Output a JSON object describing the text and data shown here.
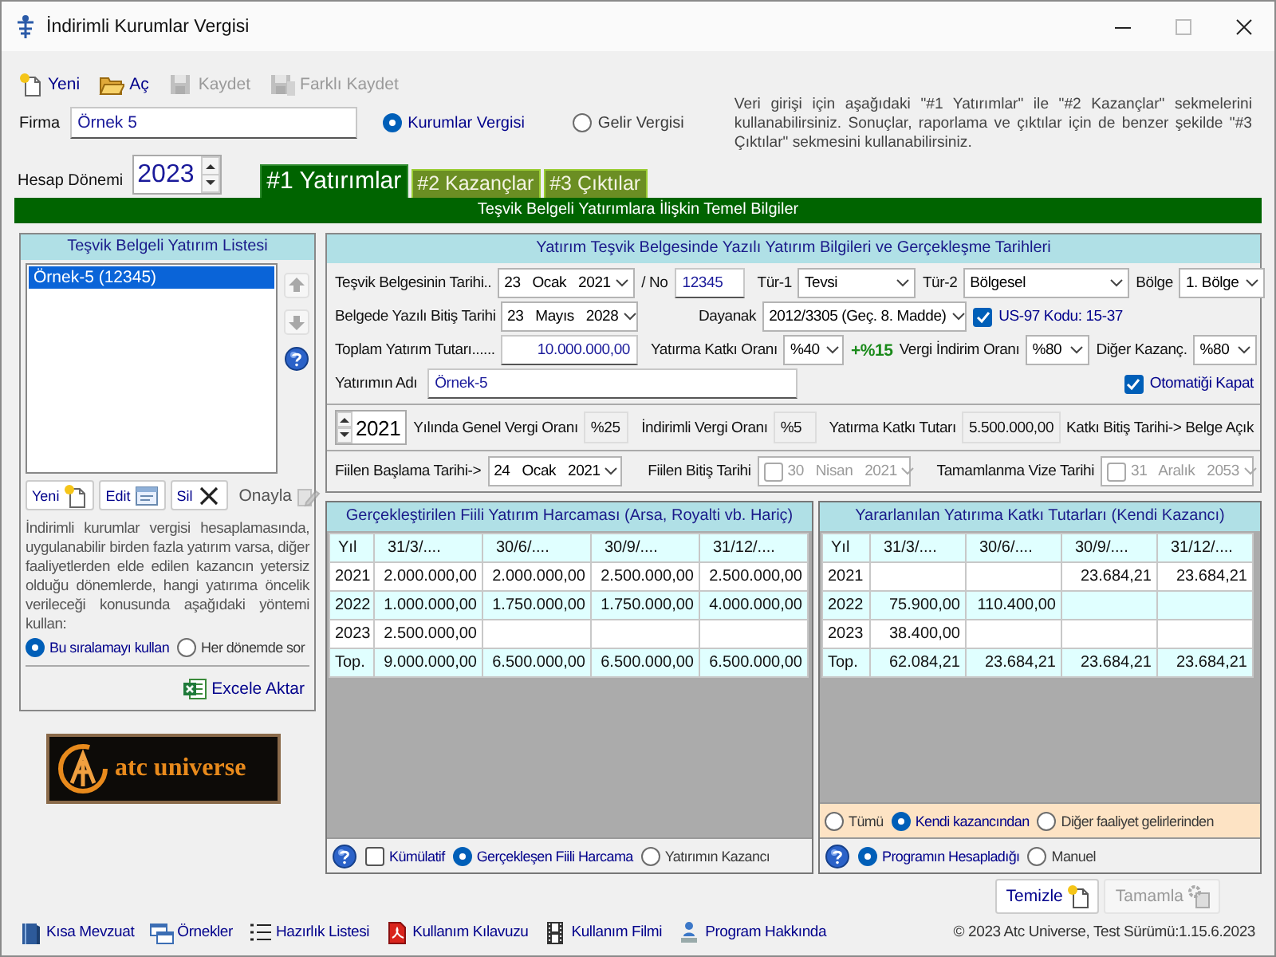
{
  "window": {
    "title": "İndirimli Kurumlar Vergisi"
  },
  "toolbar": [
    {
      "label": "Yeni",
      "kind": "new",
      "disabled": false
    },
    {
      "label": "Aç",
      "kind": "open",
      "disabled": false
    },
    {
      "label": "Kaydet",
      "kind": "save",
      "disabled": true
    },
    {
      "label": "Farklı Kaydet",
      "kind": "save_as",
      "disabled": true
    }
  ],
  "company": {
    "label": "Firma",
    "value": "Örnek 5"
  },
  "tax_type": [
    {
      "label": "Kurumlar Vergisi",
      "selected": true
    },
    {
      "label": "Gelir Vergisi",
      "selected": false
    }
  ],
  "info_text": "Veri girişi için aşağıdaki \"#1 Yatırımlar\" ile \"#2 Kazançlar\" sekmelerini kullanabilirsiniz. Sonuçlar, raporlama ve çıktılar için de benzer şekilde \"#3 Çıktılar\" sekmesini kullanabilirsiniz.",
  "period": {
    "label": "Hesap Dönemi",
    "value": "2023"
  },
  "tabs": [
    {
      "label": "#1 Yatırımlar",
      "selected": true
    },
    {
      "label": "#2 Kazançlar",
      "selected": false
    },
    {
      "label": "#3 Çıktılar",
      "selected": false
    }
  ],
  "section_title": "Teşvik Belgeli Yatırımlara İlişkin Temel Bilgiler",
  "investment_list": {
    "title": "Teşvik Belgeli Yatırım Listesi",
    "items": [
      {
        "label": "Örnek-5 (12345)",
        "selected": true
      }
    ],
    "buttons": [
      {
        "label": "Yeni",
        "kind": "new",
        "disabled": false
      },
      {
        "label": "Edit",
        "kind": "edit",
        "disabled": false
      },
      {
        "label": "Sil",
        "kind": "delete",
        "disabled": false
      },
      {
        "label": "Onayla",
        "kind": "approve",
        "disabled": true
      }
    ],
    "note": "İndirimli kurumlar vergisi hesaplamasında, uygulanabilir birden fazla yatırım varsa, diğer faaliyetlerden elde edilen kazancın yetersiz olduğu dönemlerde, hangi yatırıma öncelik verileceği konusunda aşağıdaki yöntemi kullan:",
    "order_options": [
      {
        "label": "Bu sıralamayı kullan",
        "selected": true
      },
      {
        "label": "Her dönemde sor",
        "selected": false
      }
    ],
    "export": "Excele Aktar"
  },
  "logo": {
    "text": "atc universe"
  },
  "details": {
    "title": "Yatırım Teşvik Belgesinde Yazılı Yatırım Bilgileri ve Gerçekleşme Tarihleri",
    "certificate_date": {
      "label": "Teşvik Belgesinin Tarihi..",
      "date": "23 Ocak 2021"
    },
    "certificate_no": {
      "label": "/ No",
      "value": "12345"
    },
    "type_1": {
      "label": "Tür-1",
      "value": "Tevsi"
    },
    "type_2": {
      "label": "Tür-2",
      "value": "Bölgesel"
    },
    "region": {
      "label": "Bölge",
      "value": "1. Bölge"
    },
    "end_date": {
      "label": "Belgede Yazılı Bitiş Tarihi",
      "date": "23 Mayıs 2028"
    },
    "basis": {
      "label": "Dayanak",
      "value": "2012/3305 (Geç. 8. Madde)"
    },
    "us97": {
      "label": "US-97 Kodu: 15-37",
      "checked": true
    },
    "total_amount": {
      "label": "Toplam Yatırım Tutarı......",
      "value": "10.000.000,00"
    },
    "contribution_rate": {
      "label": "Yatırma Katkı Oranı",
      "value": "%40",
      "extra": "+%15"
    },
    "tax_reduction_rate": {
      "label": "Vergi İndirim Oranı",
      "value": "%80"
    },
    "other_income": {
      "label": "Diğer Kazanç.",
      "value": "%80"
    },
    "investment_name": {
      "label": "Yatırımın Adı",
      "value": "Örnek-5"
    },
    "auto_close": {
      "label": "Otomatiği Kapat",
      "checked": true
    },
    "tax_year": {
      "value": "2021"
    },
    "general_rate": {
      "label": "Yılında Genel Vergi Oranı",
      "value": "%25"
    },
    "reduced_rate": {
      "label": "İndirimli Vergi Oranı",
      "value": "%5"
    },
    "contribution_amount": {
      "label": "Yatırma Katkı Tutarı",
      "value": "5.500.000,00"
    },
    "contribution_end": "Katkı Bitiş Tarihi-> Belge Açık",
    "start_date": {
      "label": "Fiilen Başlama Tarihi->",
      "date": "24 Ocak 2021"
    },
    "finish_date": {
      "label": "Fiilen Bitiş Tarihi",
      "checked": false,
      "date": "30 Nisan 2021"
    },
    "visa_date": {
      "label": "Tamamlanma Vize Tarihi",
      "checked": false,
      "date": "31 Aralık 2053"
    }
  },
  "grids": [
    {
      "title": "Gerçekleştirilen Fiili Yatırım Harcaması (Arsa, Royalti vb. Hariç)",
      "columns": [
        "Yıl",
        "31/3/....",
        "30/6/....",
        "30/9/....",
        "31/12/...."
      ],
      "rows": [
        [
          "2021",
          "2.000.000,00",
          "2.000.000,00",
          "2.500.000,00",
          "2.500.000,00"
        ],
        [
          "2022",
          "1.000.000,00",
          "1.750.000,00",
          "1.750.000,00",
          "4.000.000,00"
        ],
        [
          "2023",
          "2.500.000,00",
          null,
          null,
          null
        ],
        [
          "Top.",
          "9.000.000,00",
          "6.500.000,00",
          "6.500.000,00",
          "6.500.000,00"
        ]
      ],
      "option_rows": [
        {
          "shaded": false,
          "items": [
            {
              "kind": "help"
            },
            {
              "kind": "checkbox",
              "label": "Kümülatif",
              "checked": false
            },
            {
              "kind": "radio",
              "label": "Gerçekleşen Fiili Harcama",
              "selected": true
            },
            {
              "kind": "radio",
              "label": "Yatırımın Kazancı",
              "selected": false
            }
          ]
        }
      ]
    },
    {
      "title": "Yararlanılan Yatırıma Katkı Tutarları (Kendi Kazancı)",
      "columns": [
        "Yıl",
        "31/3/....",
        "30/6/....",
        "30/9/....",
        "31/12/...."
      ],
      "rows": [
        [
          "2021",
          null,
          null,
          "23.684,21",
          "23.684,21"
        ],
        [
          "2022",
          "75.900,00",
          "110.400,00",
          null,
          null
        ],
        [
          "2023",
          "38.400,00",
          null,
          null,
          null
        ],
        [
          "Top.",
          "62.084,21",
          "23.684,21",
          "23.684,21",
          "23.684,21"
        ]
      ],
      "option_rows": [
        {
          "shaded": true,
          "items": [
            {
              "kind": "radio",
              "label": "Tümü",
              "selected": false
            },
            {
              "kind": "radio",
              "label": "Kendi kazancından",
              "selected": true
            },
            {
              "kind": "radio",
              "label": "Diğer faaliyet gelirlerinden",
              "selected": false
            }
          ]
        },
        {
          "shaded": false,
          "items": [
            {
              "kind": "help"
            },
            {
              "kind": "radio",
              "label": "Programın Hesapladığı",
              "selected": true
            },
            {
              "kind": "radio",
              "label": "Manuel",
              "selected": false
            }
          ]
        }
      ]
    }
  ],
  "actions": [
    {
      "label": "Temizle",
      "kind": "clear",
      "disabled": false
    },
    {
      "label": "Tamamla",
      "kind": "complete",
      "disabled": true
    }
  ],
  "status_links": [
    {
      "label": "Kısa Mevzuat",
      "kind": "book"
    },
    {
      "label": "Örnekler",
      "kind": "windows"
    },
    {
      "label": "Hazırlık Listesi",
      "kind": "list"
    },
    {
      "label": "Kullanım Kılavuzu",
      "kind": "pdf"
    },
    {
      "label": "Kullanım Filmi",
      "kind": "film"
    },
    {
      "label": "Program Hakkında",
      "kind": "about"
    }
  ],
  "copyright": "© 2023 Atc Universe, Test Sürümü:1.15.6.2023"
}
